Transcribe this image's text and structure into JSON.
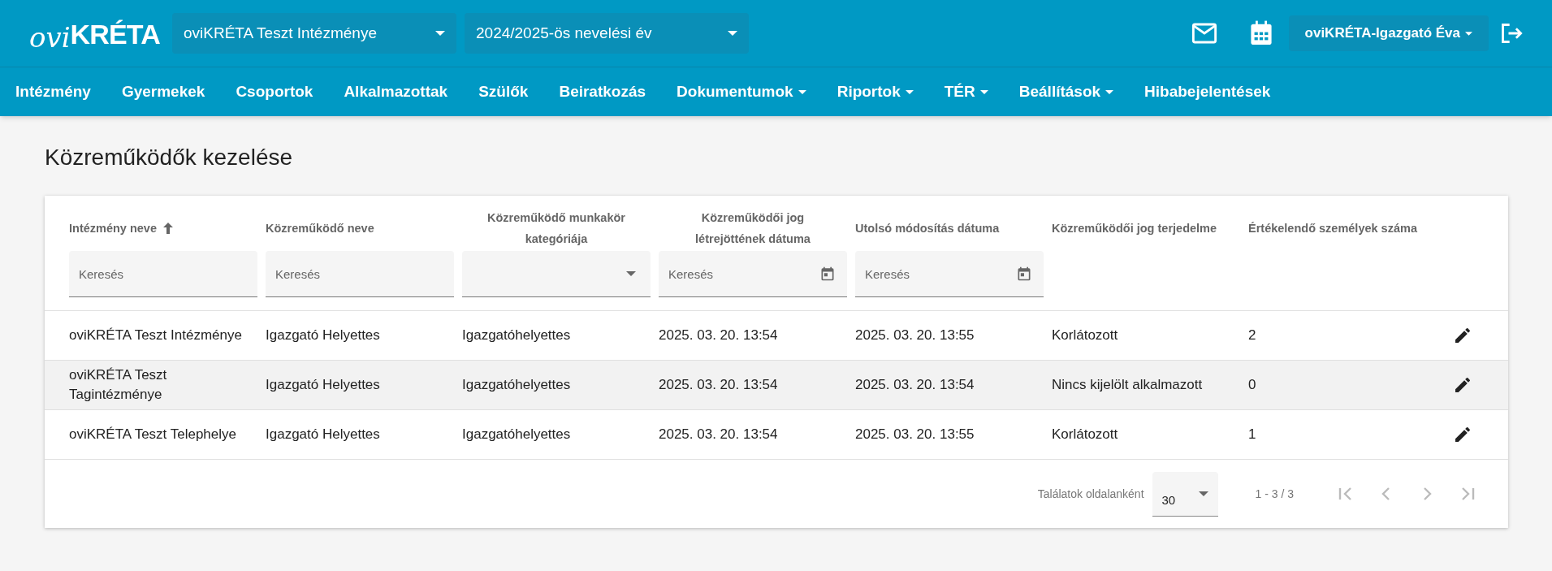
{
  "header": {
    "logo_prefix": "ovi",
    "logo_main": "KRÉTA",
    "institution_select": "oviKRÉTA Teszt Intézménye",
    "year_select": "2024/2025-ös nevelési év",
    "user_menu": "oviKRÉTA-Igazgató Éva"
  },
  "nav": [
    {
      "label": "Intézmény",
      "dropdown": false
    },
    {
      "label": "Gyermekek",
      "dropdown": false
    },
    {
      "label": "Csoportok",
      "dropdown": false
    },
    {
      "label": "Alkalmazottak",
      "dropdown": false
    },
    {
      "label": "Szülők",
      "dropdown": false
    },
    {
      "label": "Beiratkozás",
      "dropdown": false
    },
    {
      "label": "Dokumentumok",
      "dropdown": true
    },
    {
      "label": "Riportok",
      "dropdown": true
    },
    {
      "label": "TÉR",
      "dropdown": true
    },
    {
      "label": "Beállítások",
      "dropdown": true
    },
    {
      "label": "Hibabejelentések",
      "dropdown": false
    }
  ],
  "page_title": "Közreműködők kezelése",
  "table": {
    "columns": [
      {
        "label": "Intézmény neve",
        "sorted": true,
        "filter": {
          "kind": "text",
          "placeholder": "Keresés"
        }
      },
      {
        "label": "Közreműködő neve",
        "sorted": false,
        "filter": {
          "kind": "text",
          "placeholder": "Keresés"
        }
      },
      {
        "label": "Közreműködő munkakör kategóriája",
        "sorted": false,
        "filter": {
          "kind": "select"
        }
      },
      {
        "label": "Közreműködői jog létrejöttének dátuma",
        "sorted": false,
        "filter": {
          "kind": "date",
          "placeholder": "Keresés"
        }
      },
      {
        "label": "Utolsó módosítás dátuma",
        "sorted": false,
        "filter": {
          "kind": "date",
          "placeholder": "Keresés"
        }
      },
      {
        "label": "Közreműködői jog terjedelme",
        "sorted": false
      },
      {
        "label": "Értékelendő személyek száma",
        "sorted": false
      }
    ],
    "rows": [
      {
        "highlighted": false,
        "cells": [
          "oviKRÉTA Teszt Intézménye",
          "Igazgató Helyettes",
          "Igazgatóhelyettes",
          "2025. 03. 20. 13:54",
          "2025. 03. 20. 13:55",
          "Korlátozott",
          "2"
        ]
      },
      {
        "highlighted": true,
        "cells": [
          "oviKRÉTA Teszt Tagintézménye",
          "Igazgató Helyettes",
          "Igazgatóhelyettes",
          "2025. 03. 20. 13:54",
          "2025. 03. 20. 13:54",
          "Nincs kijelölt alkalmazott",
          "0"
        ]
      },
      {
        "highlighted": false,
        "cells": [
          "oviKRÉTA Teszt Telephelye",
          "Igazgató Helyettes",
          "Igazgatóhelyettes",
          "2025. 03. 20. 13:54",
          "2025. 03. 20. 13:55",
          "Korlátozott",
          "1"
        ]
      }
    ]
  },
  "pagination": {
    "per_page_label": "Találatok oldalanként",
    "per_page": "30",
    "range": "1 - 3 / 3"
  }
}
